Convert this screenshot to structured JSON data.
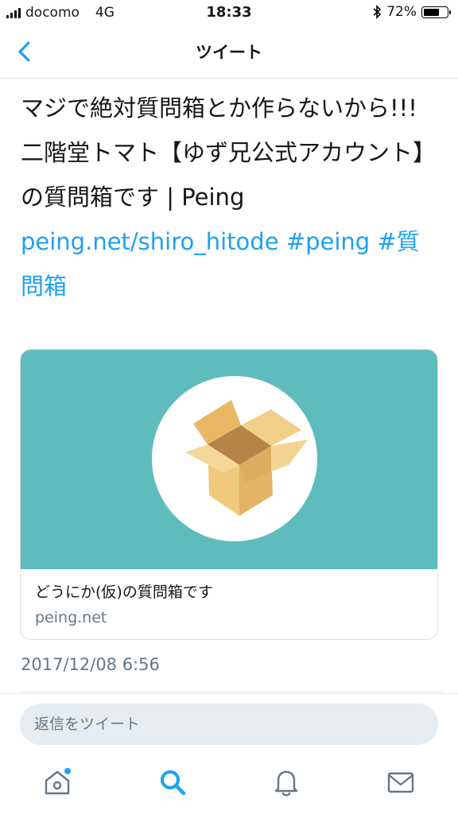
{
  "status_bar": {
    "carrier": "docomo",
    "network": "4G",
    "time": "18:33",
    "battery_percent": "72%",
    "battery_level": 0.72
  },
  "nav": {
    "title": "ツイート"
  },
  "tweet": {
    "paragraph1": "マジで絶対質問箱とか作らないから!!!",
    "paragraph2_text": "二階堂トマト【ゆず兄公式アカウント】の質問箱です | Peing ",
    "link_url": "peing.net/shiro_hitode",
    "hashtag1": "#peing",
    "hashtag2": "#質問箱"
  },
  "card": {
    "title": "どうにか(仮)の質問箱です",
    "domain": "peing.net",
    "image_bg": "#5fbcbc"
  },
  "timestamp": "2017/12/08 6:56",
  "reply": {
    "placeholder": "返信をツイート"
  },
  "tabs": [
    {
      "icon": "home-icon",
      "has_notification_dot": true
    },
    {
      "icon": "search-icon",
      "active": true
    },
    {
      "icon": "bell-icon"
    },
    {
      "icon": "mail-icon"
    }
  ],
  "colors": {
    "accent": "#1da1f2",
    "secondary_text": "#657786"
  }
}
